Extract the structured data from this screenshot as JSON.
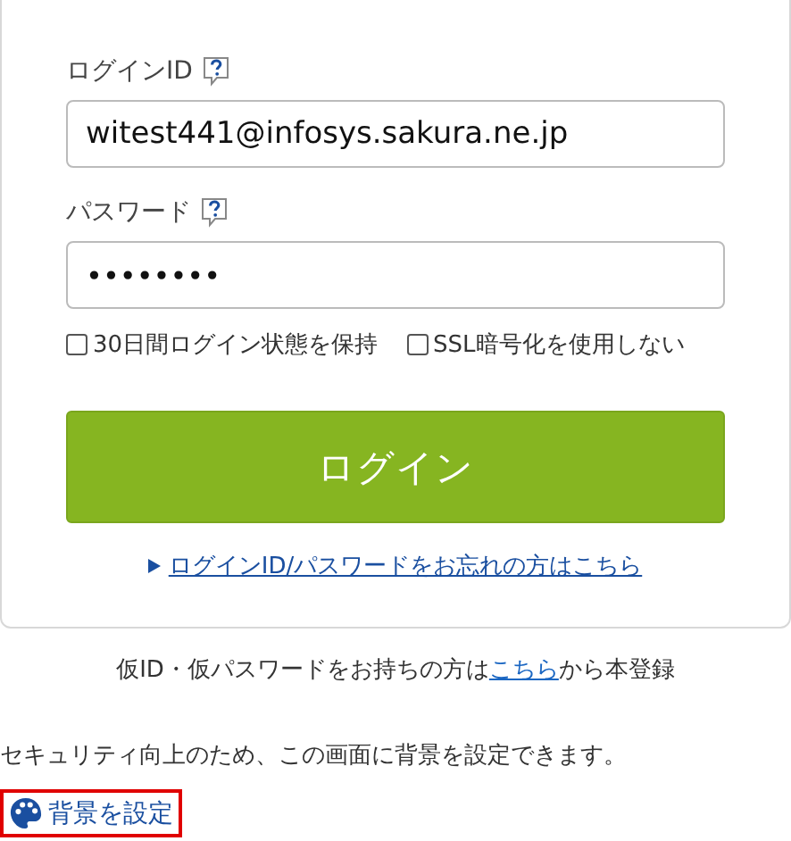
{
  "login_form": {
    "fields": [
      {
        "label": "ログインID",
        "value": "witest441@infosys.sakura.ne.jp",
        "kind": "text"
      },
      {
        "label": "パスワード",
        "value": "••••••••",
        "kind": "password"
      }
    ],
    "options": [
      {
        "label": "30日間ログイン状態を保持",
        "checked": false
      },
      {
        "label": "SSL暗号化を使用しない",
        "checked": false
      }
    ],
    "submit": "ログイン",
    "forgot_link": "ログインID/パスワードをお忘れの方はこちら"
  },
  "registration": {
    "before": "仮ID・仮パスワードをお持ちの方は",
    "link": "こちら",
    "after": "から本登録"
  },
  "security_note": "セキュリティ向上のため、この画面に背景を設定できます。",
  "background_link": {
    "label": "背景を設定",
    "highlighted": true
  }
}
